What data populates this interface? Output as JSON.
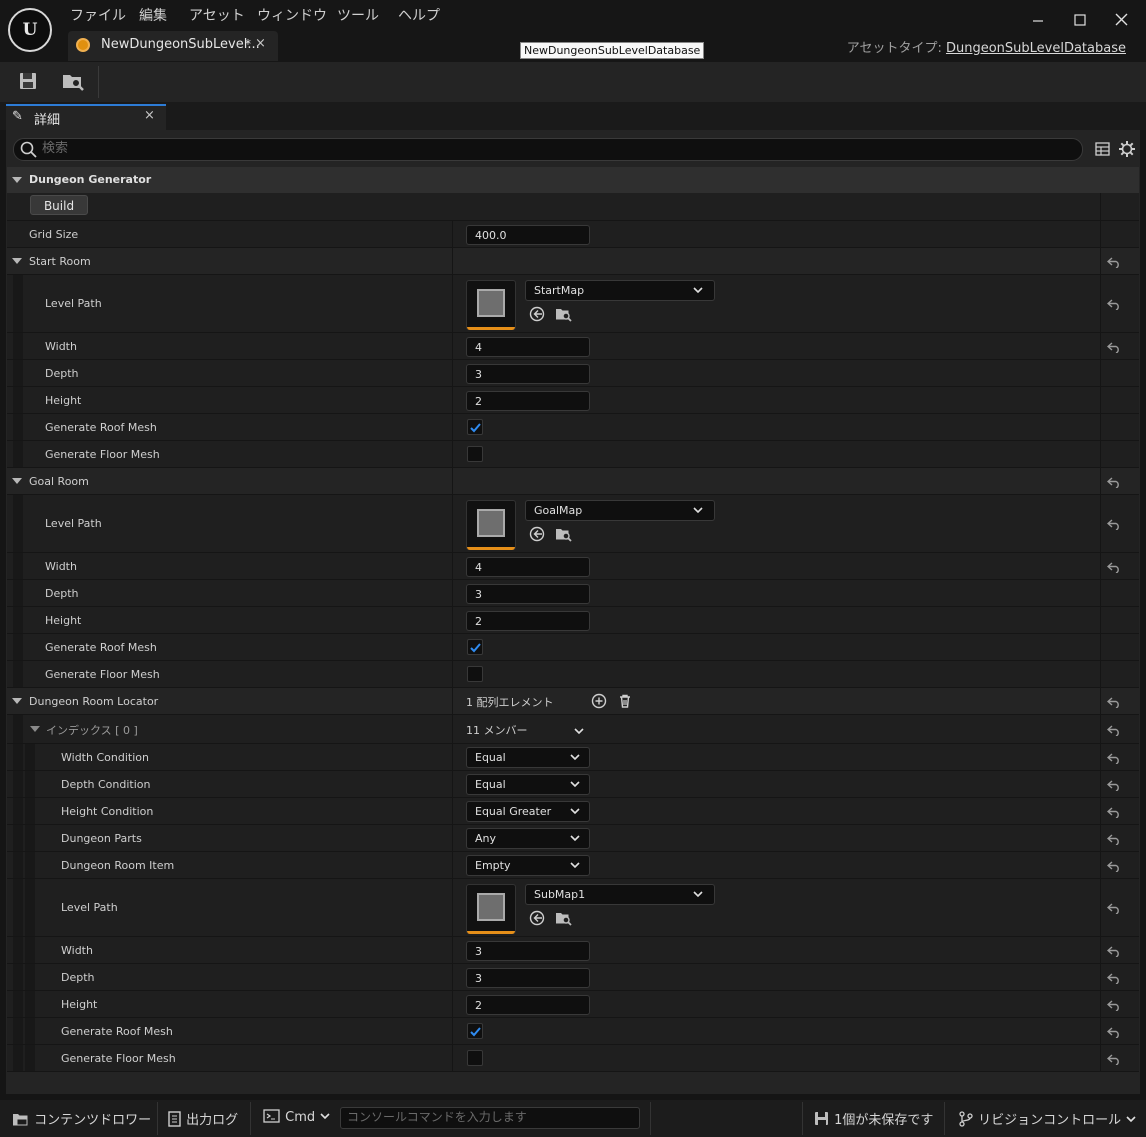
{
  "app": {
    "logo": "ue-logo",
    "menu": [
      "ファイル",
      "編集",
      "アセット",
      "ウィンドウ",
      "ツール",
      "ヘルプ"
    ],
    "window_controls": {
      "minimize": "—",
      "maximize": "☐",
      "close": "✕"
    }
  },
  "document_tab": {
    "title": "NewDungeonSubLevel...",
    "modified": "*",
    "close": "×",
    "tooltip": "NewDungeonSubLevelDatabase"
  },
  "asset_type": {
    "label": "アセットタイプ:",
    "value": "DungeonSubLevelDatabase"
  },
  "toolbar": {
    "icons": [
      "save-icon",
      "browse-icon"
    ]
  },
  "details_tab": {
    "label": "詳細",
    "close": "×"
  },
  "search": {
    "placeholder": "検索"
  },
  "categories": {
    "dungeon_generator": {
      "label": "Dungeon Generator",
      "build_button": "Build",
      "grid_size": {
        "label": "Grid Size",
        "value": "400.0"
      }
    },
    "start_room": {
      "label": "Start Room",
      "level_path": {
        "label": "Level Path",
        "value": "StartMap"
      },
      "width": {
        "label": "Width",
        "value": "4"
      },
      "depth": {
        "label": "Depth",
        "value": "3"
      },
      "height": {
        "label": "Height",
        "value": "2"
      },
      "roof": {
        "label": "Generate Roof Mesh",
        "checked": true
      },
      "floor": {
        "label": "Generate Floor Mesh",
        "checked": false
      }
    },
    "goal_room": {
      "label": "Goal Room",
      "level_path": {
        "label": "Level Path",
        "value": "GoalMap"
      },
      "width": {
        "label": "Width",
        "value": "4"
      },
      "depth": {
        "label": "Depth",
        "value": "3"
      },
      "height": {
        "label": "Height",
        "value": "2"
      },
      "roof": {
        "label": "Generate Roof Mesh",
        "checked": true
      },
      "floor": {
        "label": "Generate Floor Mesh",
        "checked": false
      }
    },
    "room_locator": {
      "label": "Dungeon Room Locator",
      "count": "1 配列エレメント",
      "index": {
        "label": "インデックス [ 0 ]",
        "members": "11 メンバー"
      },
      "width_condition": {
        "label": "Width Condition",
        "value": "Equal"
      },
      "depth_condition": {
        "label": "Depth Condition",
        "value": "Equal"
      },
      "height_condition": {
        "label": "Height Condition",
        "value": "Equal Greater"
      },
      "dungeon_parts": {
        "label": "Dungeon Parts",
        "value": "Any"
      },
      "room_item": {
        "label": "Dungeon Room Item",
        "value": "Empty"
      },
      "level_path": {
        "label": "Level Path",
        "value": "SubMap1"
      },
      "width": {
        "label": "Width",
        "value": "3"
      },
      "depth": {
        "label": "Depth",
        "value": "3"
      },
      "height": {
        "label": "Height",
        "value": "2"
      },
      "roof": {
        "label": "Generate Roof Mesh",
        "checked": true
      },
      "floor": {
        "label": "Generate Floor Mesh",
        "checked": false
      }
    }
  },
  "statusbar": {
    "content_drawer": "コンテンツドロワー",
    "output_log": "出力ログ",
    "cmd": "Cmd",
    "console_placeholder": "コンソールコマンドを入力します",
    "unsaved": "1個が未保存です",
    "revision_control": "リビジョンコントロール"
  },
  "colors": {
    "accent_blue": "#2d7cd6",
    "asset_orange": "#e68f19",
    "checkmark_blue": "#2f8bf0"
  }
}
